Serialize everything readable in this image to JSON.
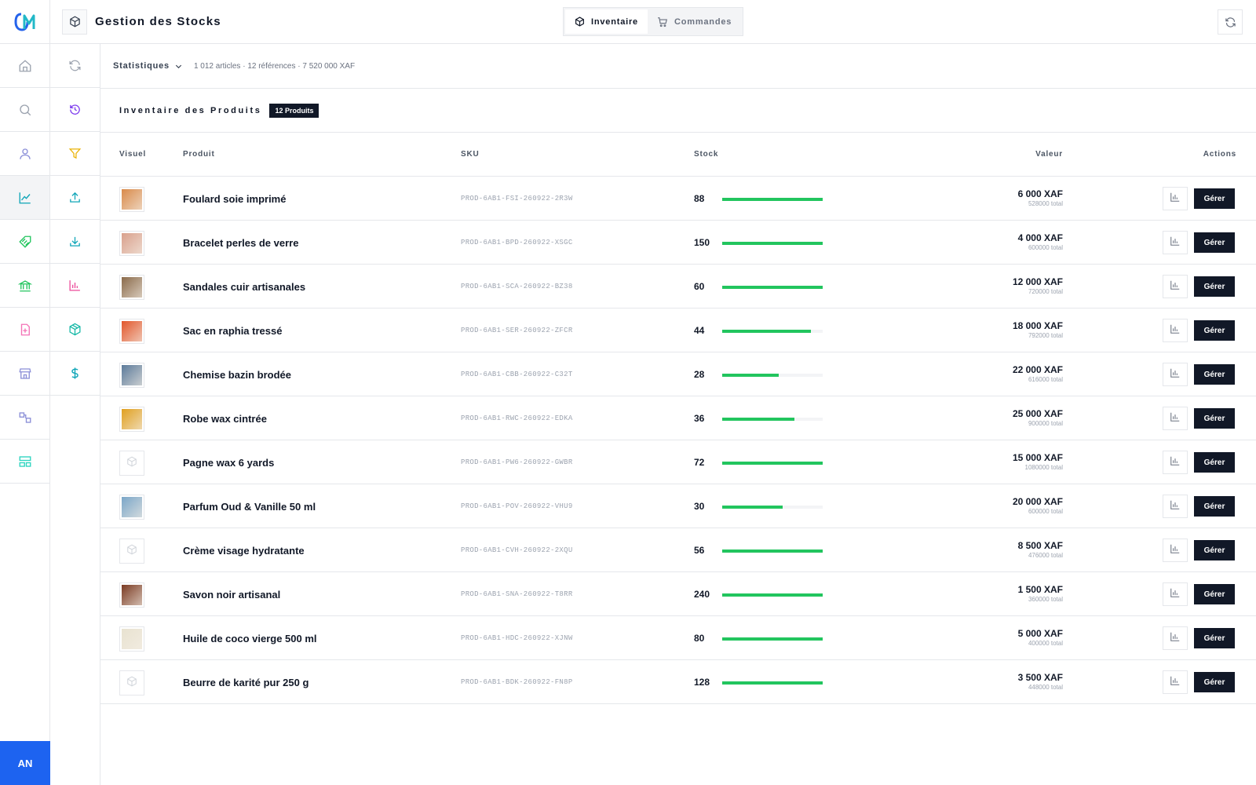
{
  "header": {
    "title": "Gestion des Stocks",
    "tabs": [
      {
        "label": "Inventaire",
        "icon": "cube-icon",
        "active": true
      },
      {
        "label": "Commandes",
        "icon": "cart-icon",
        "active": false
      }
    ]
  },
  "sidebar": {
    "items": [
      {
        "icon": "home-icon"
      },
      {
        "icon": "search-icon"
      },
      {
        "icon": "user-icon"
      },
      {
        "icon": "chart-line-icon",
        "active": true
      },
      {
        "icon": "tag-icon"
      },
      {
        "icon": "bank-icon"
      },
      {
        "icon": "document-add-icon"
      },
      {
        "icon": "store-icon"
      },
      {
        "icon": "workflow-icon"
      },
      {
        "icon": "layout-icon"
      }
    ],
    "avatar": "AN"
  },
  "toolbar": {
    "items": [
      {
        "icon": "refresh-icon"
      },
      {
        "icon": "history-icon"
      },
      {
        "icon": "filter-icon"
      },
      {
        "icon": "upload-icon"
      },
      {
        "icon": "download-icon"
      },
      {
        "icon": "bar-chart-icon"
      },
      {
        "icon": "package-icon"
      },
      {
        "icon": "dollar-icon"
      }
    ]
  },
  "stats": {
    "label": "Statistiques",
    "summary": "1 012 articles · 12 références · 7 520 000 XAF"
  },
  "inventory": {
    "title": "Inventaire des Produits",
    "badge": "12 Produits",
    "columns": {
      "visual": "Visuel",
      "product": "Produit",
      "sku": "SKU",
      "stock": "Stock",
      "value": "Valeur",
      "actions": "Actions"
    },
    "manage_label": "Gérer",
    "products": [
      {
        "name": "Foulard soie imprimé",
        "sku": "PROD-6AB1-FSI-260922-2R3W",
        "stock": "88",
        "level": 1.0,
        "value": "6 000 XAF",
        "total": "528000 total",
        "thumb": "#d98a4a"
      },
      {
        "name": "Bracelet perles de verre",
        "sku": "PROD-6AB1-BPD-260922-XSGC",
        "stock": "150",
        "level": 1.0,
        "value": "4 000 XAF",
        "total": "600000 total",
        "thumb": "#d9a08c"
      },
      {
        "name": "Sandales cuir artisanales",
        "sku": "PROD-6AB1-SCA-260922-BZ38",
        "stock": "60",
        "level": 1.0,
        "value": "12 000 XAF",
        "total": "720000 total",
        "thumb": "#8a6a4a"
      },
      {
        "name": "Sac en raphia tressé",
        "sku": "PROD-6AB1-SER-260922-ZFCR",
        "stock": "44",
        "level": 0.88,
        "value": "18 000 XAF",
        "total": "792000 total",
        "thumb": "#e2562a"
      },
      {
        "name": "Chemise bazin brodée",
        "sku": "PROD-6AB1-CBB-260922-C32T",
        "stock": "28",
        "level": 0.56,
        "value": "22 000 XAF",
        "total": "616000 total",
        "thumb": "#5b7a9a"
      },
      {
        "name": "Robe wax cintrée",
        "sku": "PROD-6AB1-RWC-260922-EDKA",
        "stock": "36",
        "level": 0.72,
        "value": "25 000 XAF",
        "total": "900000 total",
        "thumb": "#e0a020"
      },
      {
        "name": "Pagne wax 6 yards",
        "sku": "PROD-6AB1-PW6-260922-GWBR",
        "stock": "72",
        "level": 1.0,
        "value": "15 000 XAF",
        "total": "1080000 total",
        "thumb": ""
      },
      {
        "name": "Parfum Oud & Vanille 50 ml",
        "sku": "PROD-6AB1-POV-260922-VHU9",
        "stock": "30",
        "level": 0.6,
        "value": "20 000 XAF",
        "total": "600000 total",
        "thumb": "#7aa6c8"
      },
      {
        "name": "Crème visage hydratante",
        "sku": "PROD-6AB1-CVH-260922-2XQU",
        "stock": "56",
        "level": 1.0,
        "value": "8 500 XAF",
        "total": "476000 total",
        "thumb": ""
      },
      {
        "name": "Savon noir artisanal",
        "sku": "PROD-6AB1-SNA-260922-T8RR",
        "stock": "240",
        "level": 1.0,
        "value": "1 500 XAF",
        "total": "360000 total",
        "thumb": "#7a3a22"
      },
      {
        "name": "Huile de coco vierge 500 ml",
        "sku": "PROD-6AB1-HDC-260922-XJNW",
        "stock": "80",
        "level": 1.0,
        "value": "5 000 XAF",
        "total": "400000 total",
        "thumb": "#e8e2d0"
      },
      {
        "name": "Beurre de karité pur 250 g",
        "sku": "PROD-6AB1-BDK-260922-FN8P",
        "stock": "128",
        "level": 1.0,
        "value": "3 500 XAF",
        "total": "448000 total",
        "thumb": ""
      }
    ]
  },
  "colors": {
    "accent": "#1d63f0",
    "stock_bar": "#22c55e",
    "dark": "#111827"
  }
}
